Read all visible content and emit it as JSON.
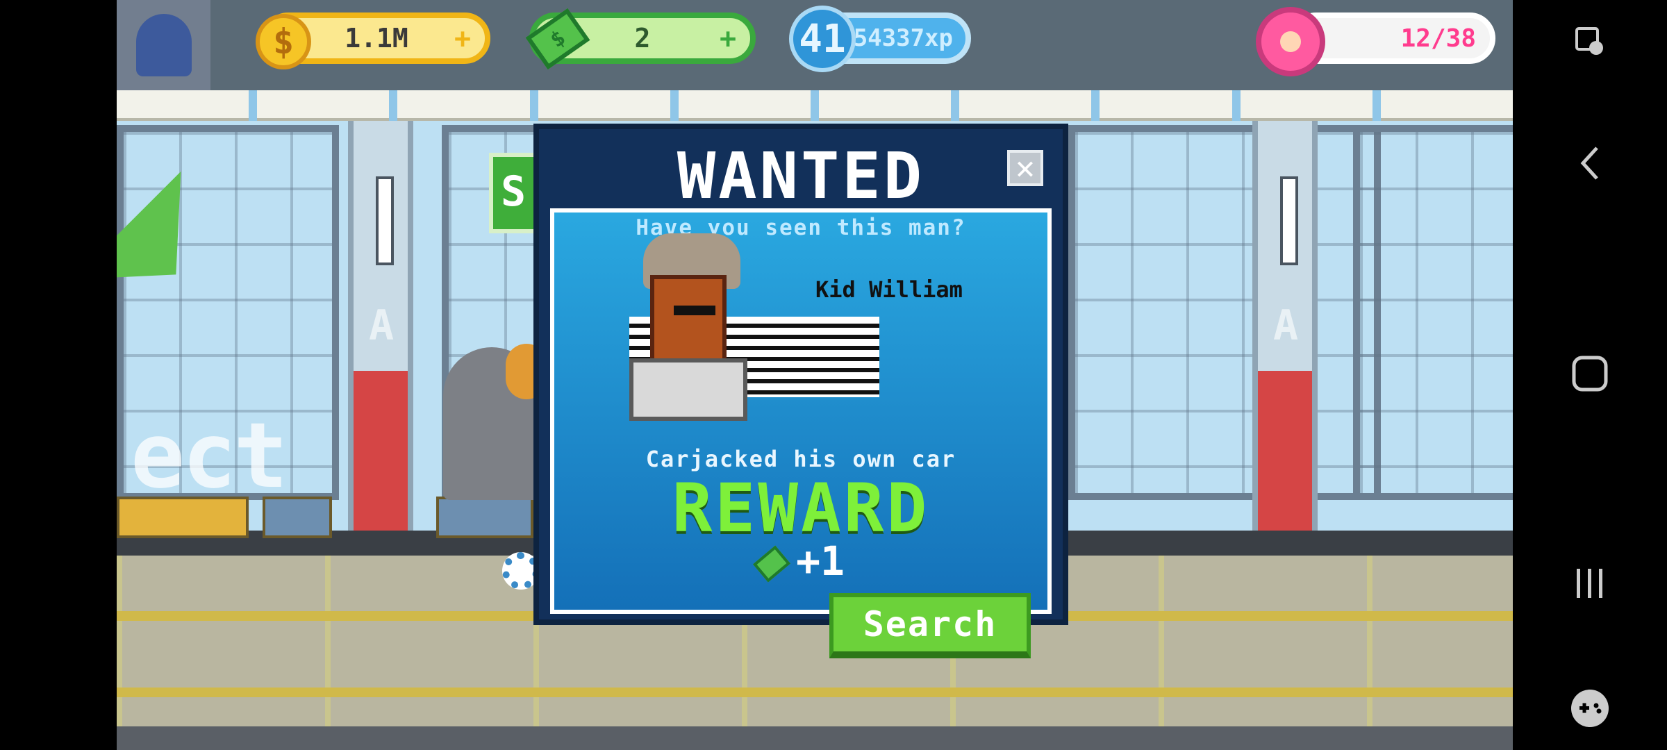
{
  "hud": {
    "coins": "1.1M",
    "cash": "2",
    "level": "41",
    "xp": "454337xp",
    "donuts": "12/38"
  },
  "background": {
    "sign_letter": "S",
    "pillar_letter": "A",
    "faded_text": "ect"
  },
  "poster": {
    "title": "WANTED",
    "close_label": "✕",
    "question": "Have you seen this man?",
    "suspect_name": "Kid William",
    "crime": "Carjacked his own car",
    "reward_label": "REWARD",
    "reward_amount": "+1",
    "search_button": "Search"
  },
  "colors": {
    "reward_green": "#7ef03a",
    "poster_blue": "#2aa8e0",
    "donut_pink": "#ff3c8e"
  }
}
